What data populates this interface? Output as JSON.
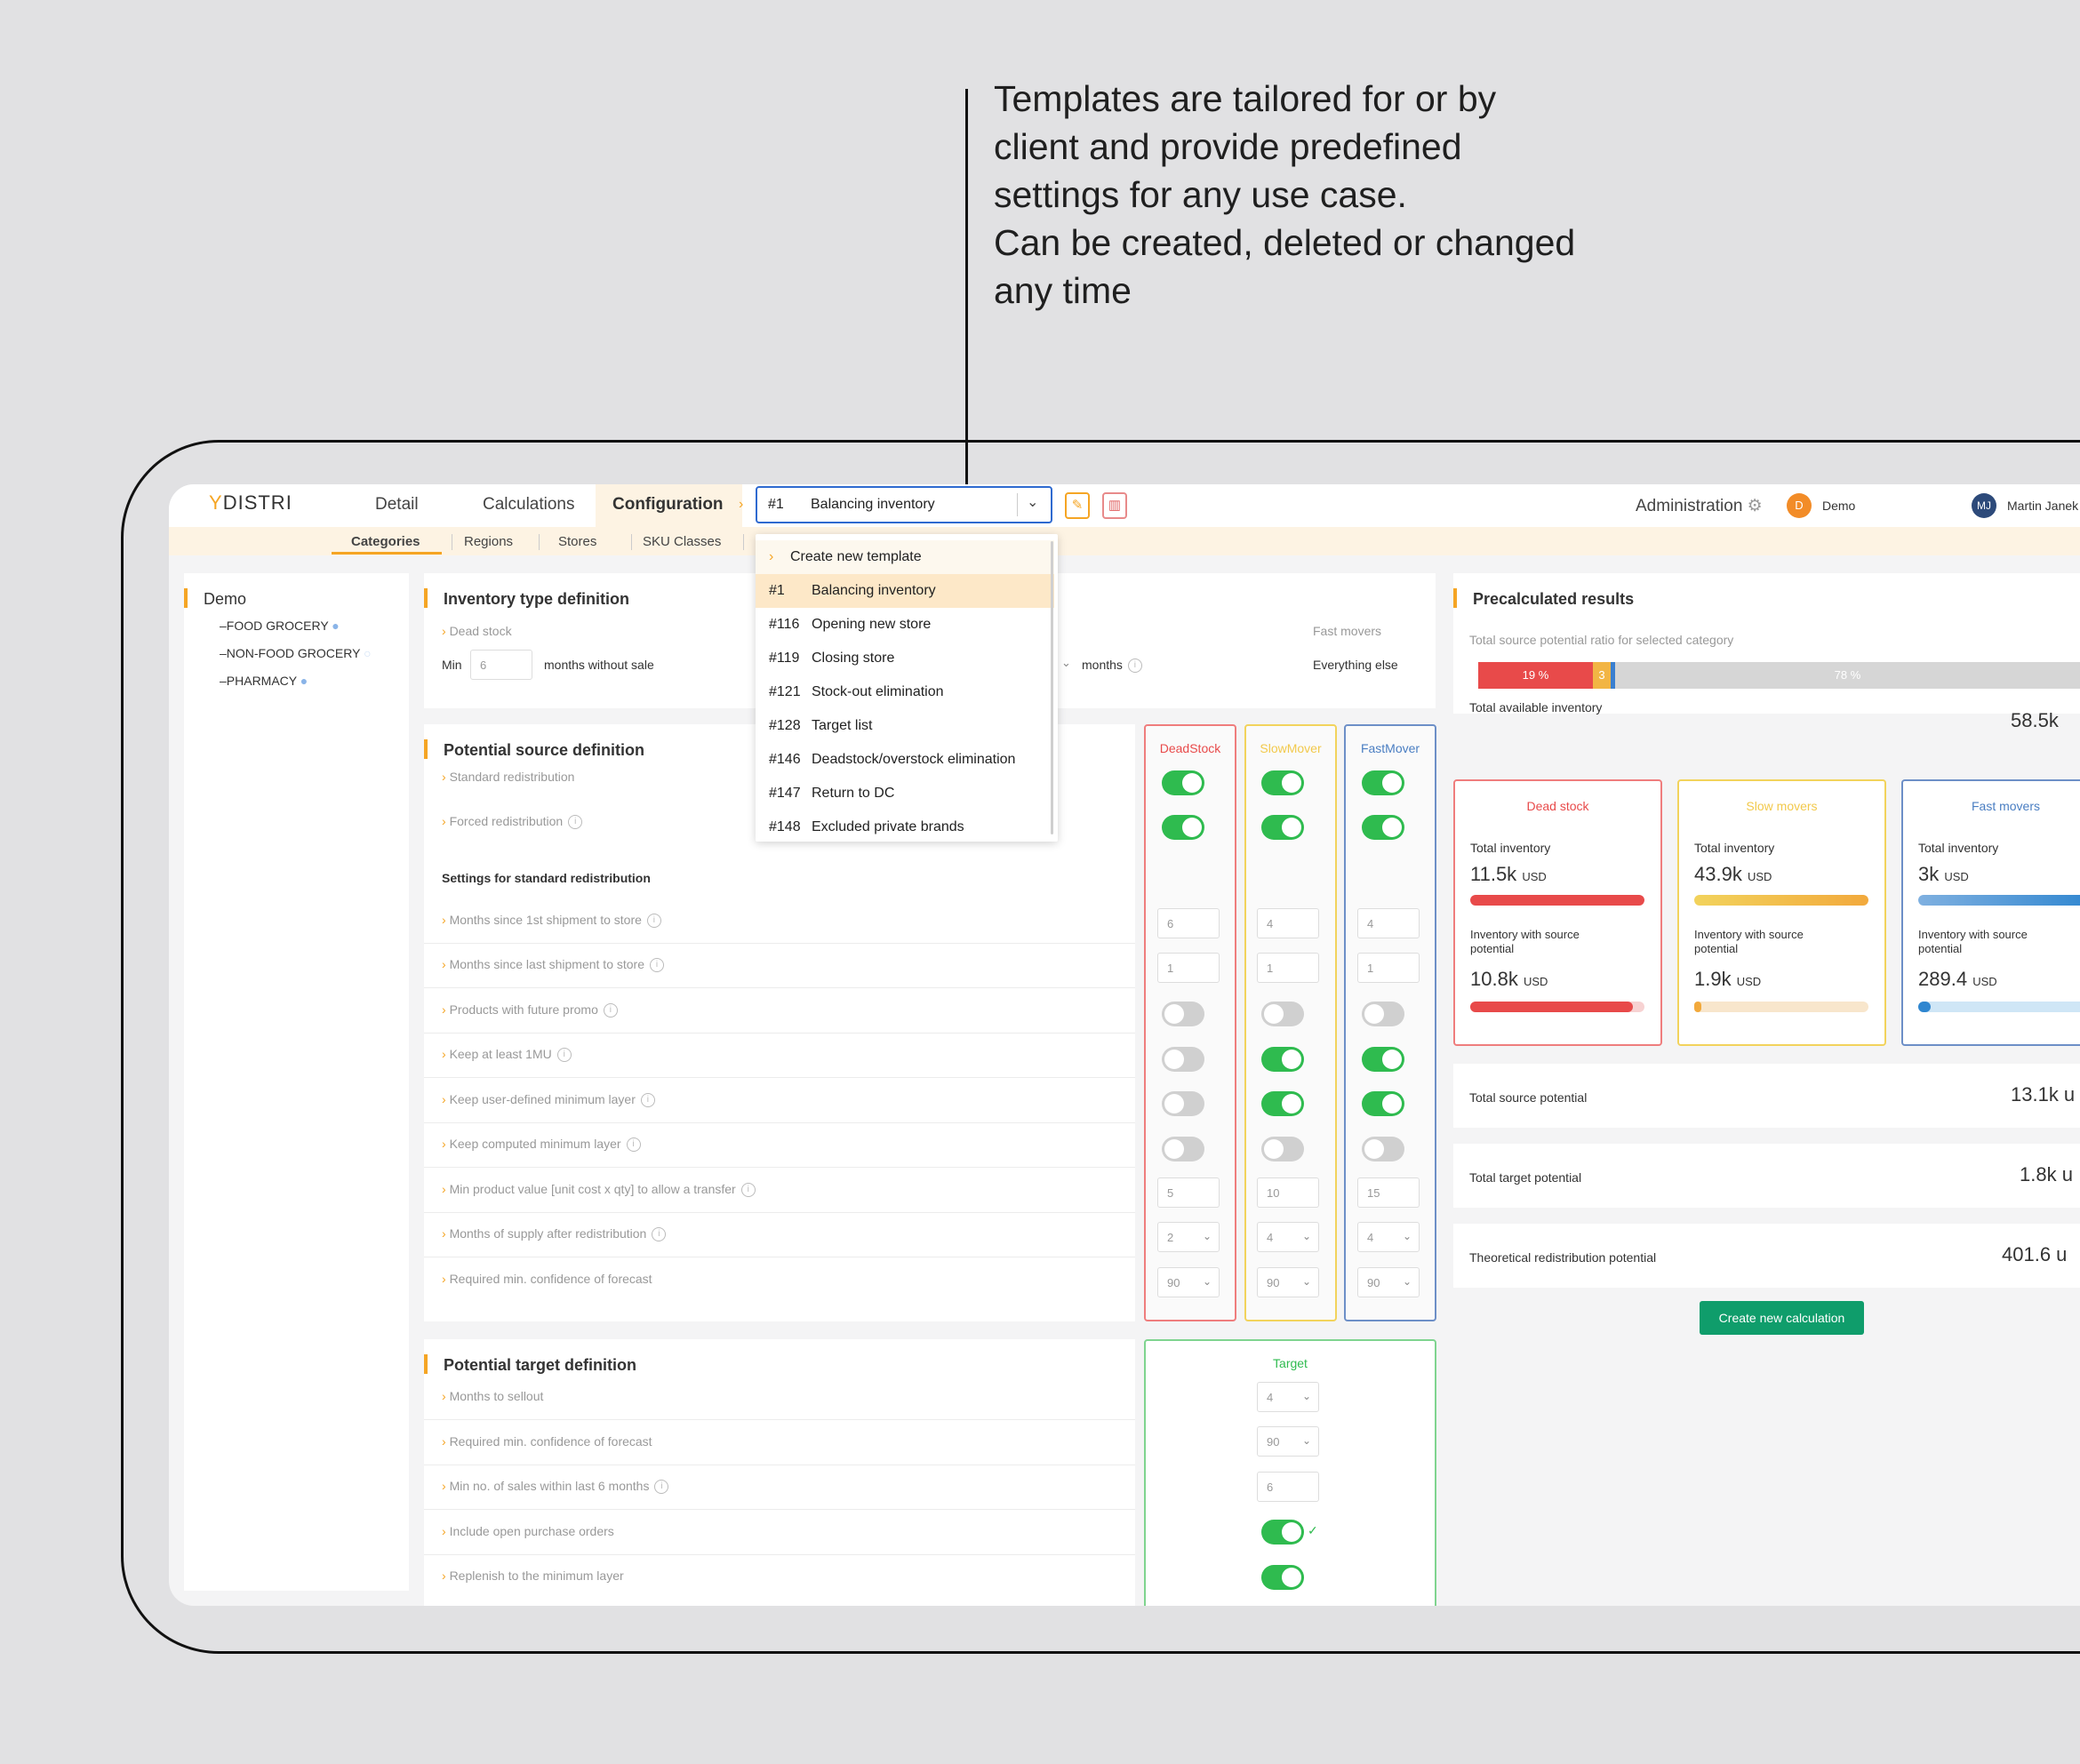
{
  "annotation": {
    "lines": [
      "Templates are tailored for or by",
      "client and provide predefined",
      "settings for any use case.",
      "Can be created, deleted or changed",
      "any time"
    ]
  },
  "header": {
    "logo_y": "Y",
    "logo_rest": "DISTRI",
    "nav": [
      "Detail",
      "Calculations",
      "Configuration"
    ],
    "template_num": "#1",
    "template_name": "Balancing inventory",
    "administration": "Administration",
    "org_avatar": "D",
    "org_name": "Demo",
    "user_avatar": "MJ",
    "user_name": "Martin Janek"
  },
  "subnav": [
    "Categories",
    "Regions",
    "Stores",
    "SKU Classes"
  ],
  "dropdown": {
    "create": "Create new template",
    "items": [
      {
        "num": "#1",
        "name": "Balancing inventory"
      },
      {
        "num": "#116",
        "name": "Opening new store"
      },
      {
        "num": "#119",
        "name": "Closing store"
      },
      {
        "num": "#121",
        "name": "Stock-out elimination"
      },
      {
        "num": "#128",
        "name": "Target list"
      },
      {
        "num": "#146",
        "name": "Deadstock/overstock elimination"
      },
      {
        "num": "#147",
        "name": "Return to DC"
      },
      {
        "num": "#148",
        "name": "Excluded private brands"
      }
    ]
  },
  "tree": {
    "root": "Demo",
    "children": [
      "–FOOD GROCERY",
      "–NON-FOOD GROCERY",
      "–PHARMACY"
    ]
  },
  "inventory_type": {
    "title": "Inventory type definition",
    "dead_stock": "Dead stock",
    "min": "Min",
    "min_value": "6",
    "months_without_sale": "months without sale",
    "months": "months",
    "fast_movers": "Fast movers",
    "everything_else": "Everything else"
  },
  "source": {
    "title": "Potential source definition",
    "standard": "Standard redistribution",
    "forced": "Forced redistribution",
    "settings_title": "Settings for standard redistribution",
    "rows": [
      "Months since 1st shipment to store",
      "Months since last shipment to store",
      "Products with future promo",
      "Keep at least 1MU",
      "Keep user-defined minimum layer",
      "Keep computed minimum layer",
      "Min product value [unit cost x qty] to allow a transfer",
      "Months of supply after redistribution",
      "Required min. confidence of forecast"
    ],
    "columns": [
      "DeadStock",
      "SlowMover",
      "FastMover"
    ],
    "dead": {
      "r1": "6",
      "r2": "1",
      "r7": "5",
      "r8": "2",
      "r9": "90"
    },
    "slow": {
      "r1": "4",
      "r2": "1",
      "r7": "10",
      "r8": "4",
      "r9": "90"
    },
    "fast": {
      "r1": "4",
      "r2": "1",
      "r7": "15",
      "r8": "4",
      "r9": "90"
    }
  },
  "target": {
    "title": "Potential target definition",
    "column": "Target",
    "rows": [
      "Months to sellout",
      "Required min. confidence of forecast",
      "Min no. of sales within last 6 months",
      "Include open purchase orders",
      "Replenish to the minimum layer"
    ],
    "values": {
      "r1": "4",
      "r2": "90",
      "r3": "6"
    }
  },
  "results": {
    "title": "Precalculated results",
    "ratio_label": "Total source potential ratio for selected category",
    "seg_dead": "19 %",
    "seg_slow": "3 %",
    "seg_fast": "78 %",
    "ratio": {
      "dead": 19,
      "slow": 3,
      "fast": 78
    },
    "total_available_label": "Total available inventory",
    "total_available": "58.5k",
    "cards": [
      {
        "title": "Dead stock",
        "total_label": "Total inventory",
        "total": "11.5k",
        "unit": "USD",
        "src_label1": "Inventory with source",
        "src_label2": "potential",
        "src": "10.8k",
        "src_unit": "USD"
      },
      {
        "title": "Slow movers",
        "total_label": "Total inventory",
        "total": "43.9k",
        "unit": "USD",
        "src_label1": "Inventory with source",
        "src_label2": "potential",
        "src": "1.9k",
        "src_unit": "USD"
      },
      {
        "title": "Fast movers",
        "total_label": "Total inventory",
        "total": "3k",
        "unit": "USD",
        "src_label1": "Inventory with source",
        "src_label2": "potential",
        "src": "289.4",
        "src_unit": "USD"
      }
    ],
    "total_source_label": "Total source potential",
    "total_source": "13.1k u",
    "total_target_label": "Total target potential",
    "total_target": "1.8k u",
    "theoretical_label": "Theoretical redistribution potential",
    "theoretical": "401.6 u",
    "create_button": "Create new calculation"
  },
  "colors": {
    "accent": "#f5a524",
    "dead": "#e84a4a",
    "slow": "#f2c94c",
    "fast": "#4a7ec2",
    "toggle_on": "#2fbb4f",
    "primary_button": "#0f9d6b"
  }
}
